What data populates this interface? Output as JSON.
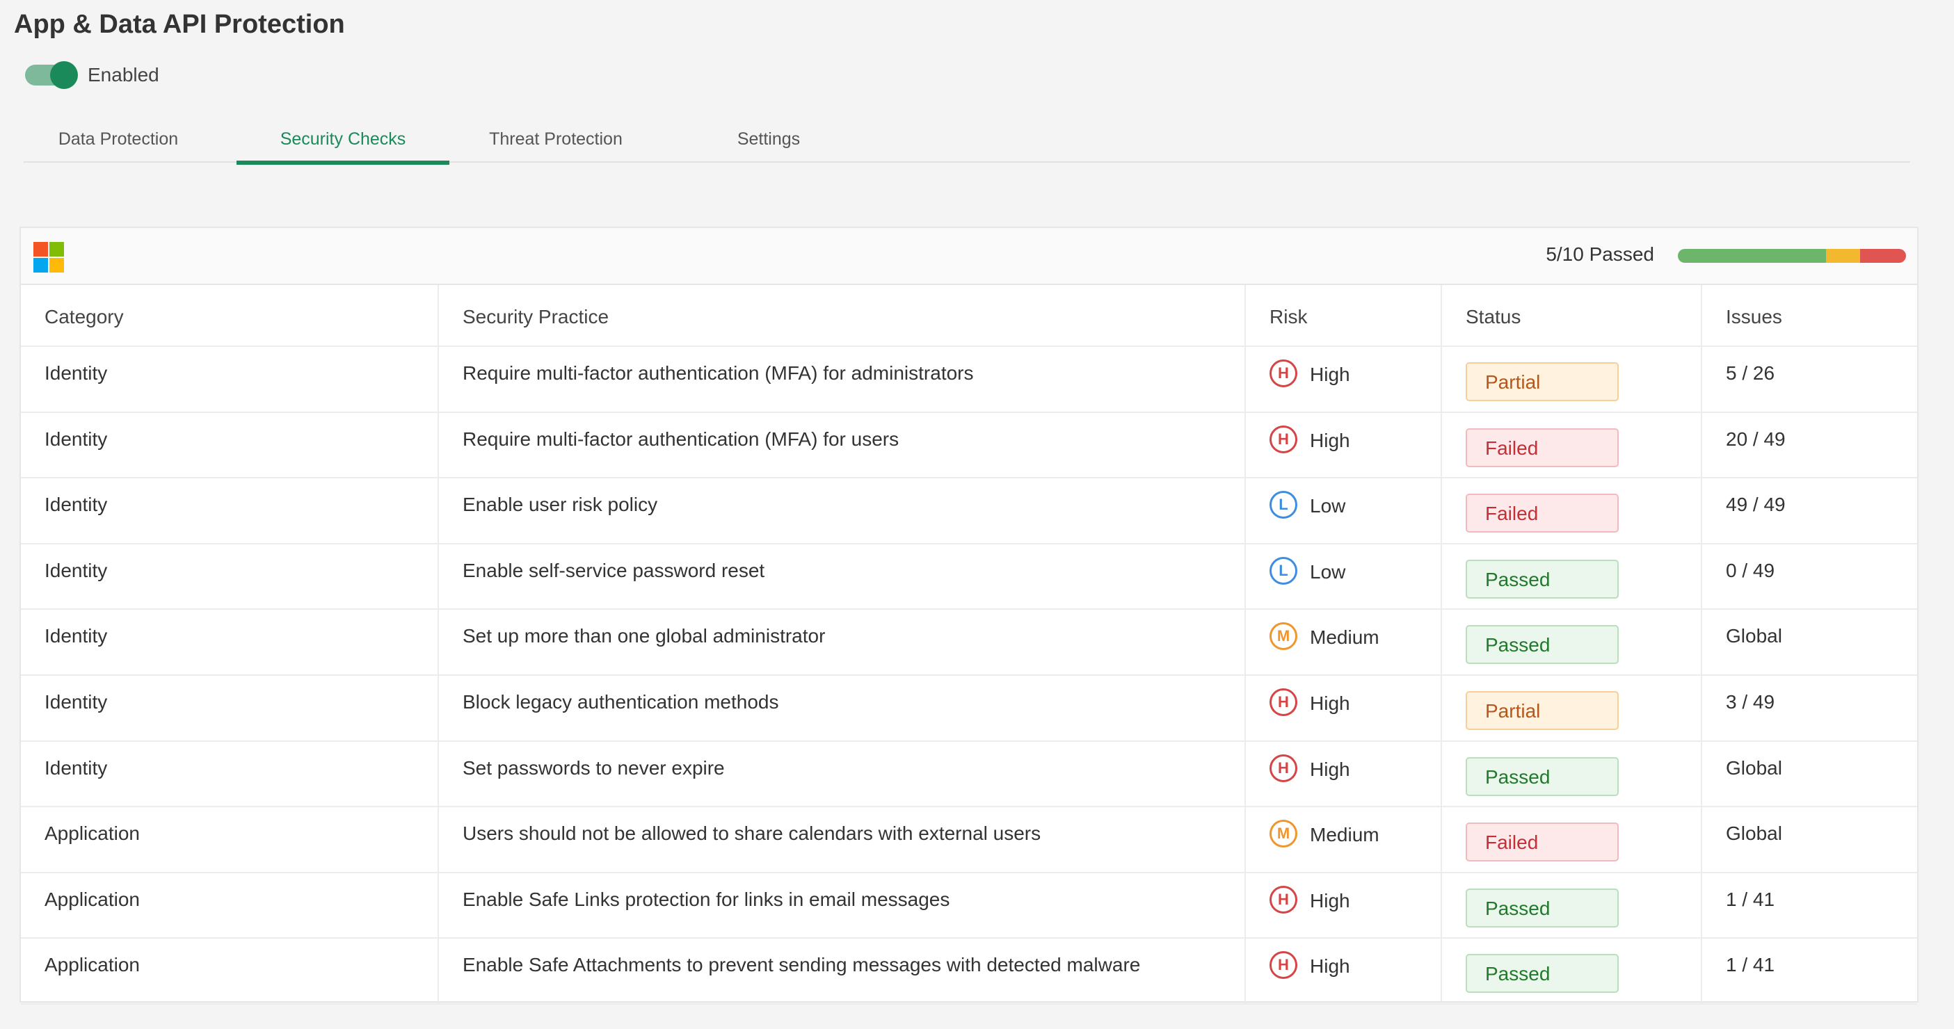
{
  "page": {
    "title": "App & Data API Protection"
  },
  "toggle": {
    "label": "Enabled",
    "on": true
  },
  "tabs": [
    {
      "label": "Data Protection",
      "active": false
    },
    {
      "label": "Security Checks",
      "active": true
    },
    {
      "label": "Threat Protection",
      "active": false
    },
    {
      "label": "Settings",
      "active": false
    }
  ],
  "summary": {
    "text": "5/10 Passed",
    "progress": {
      "passed": 0.65,
      "partial": 0.15,
      "failed": 0.2
    },
    "colors": {
      "passed": "#6cb56b",
      "partial": "#f2b92f",
      "failed": "#e05552"
    }
  },
  "logo": {
    "name": "microsoft-logo",
    "colors": [
      "#f35325",
      "#81bc06",
      "#05a6f0",
      "#ffba08"
    ]
  },
  "table": {
    "headers": [
      "Category",
      "Security Practice",
      "Risk",
      "Status",
      "Issues"
    ],
    "rows": [
      {
        "category": "Identity",
        "practice": "Require multi-factor authentication (MFA) for administrators",
        "risk_letter": "H",
        "risk": "High",
        "status": "Partial",
        "issues": "5 / 26"
      },
      {
        "category": "Identity",
        "practice": "Require multi-factor authentication (MFA) for users",
        "risk_letter": "H",
        "risk": "High",
        "status": "Failed",
        "issues": "20 / 49"
      },
      {
        "category": "Identity",
        "practice": "Enable user risk policy",
        "risk_letter": "L",
        "risk": "Low",
        "status": "Failed",
        "issues": "49 / 49"
      },
      {
        "category": "Identity",
        "practice": "Enable self-service password reset",
        "risk_letter": "L",
        "risk": "Low",
        "status": "Passed",
        "issues": "0 / 49"
      },
      {
        "category": "Identity",
        "practice": "Set up more than one global administrator",
        "risk_letter": "M",
        "risk": "Medium",
        "status": "Passed",
        "issues": "Global"
      },
      {
        "category": "Identity",
        "practice": "Block legacy authentication methods",
        "risk_letter": "H",
        "risk": "High",
        "status": "Partial",
        "issues": "3 / 49"
      },
      {
        "category": "Identity",
        "practice": "Set passwords to never expire",
        "risk_letter": "H",
        "risk": "High",
        "status": "Passed",
        "issues": "Global"
      },
      {
        "category": "Application",
        "practice": "Users should not be allowed to share calendars with external users",
        "risk_letter": "M",
        "risk": "Medium",
        "status": "Failed",
        "issues": "Global"
      },
      {
        "category": "Application",
        "practice": "Enable Safe Links protection for links in email messages",
        "risk_letter": "H",
        "risk": "High",
        "status": "Passed",
        "issues": "1 / 41"
      },
      {
        "category": "Application",
        "practice": "Enable Safe Attachments to prevent sending messages with detected malware",
        "risk_letter": "H",
        "risk": "High",
        "status": "Passed",
        "issues": "1 / 41"
      }
    ]
  },
  "risk_colors": {
    "H": "#d64545",
    "M": "#f0962d",
    "L": "#3d8ee0"
  }
}
